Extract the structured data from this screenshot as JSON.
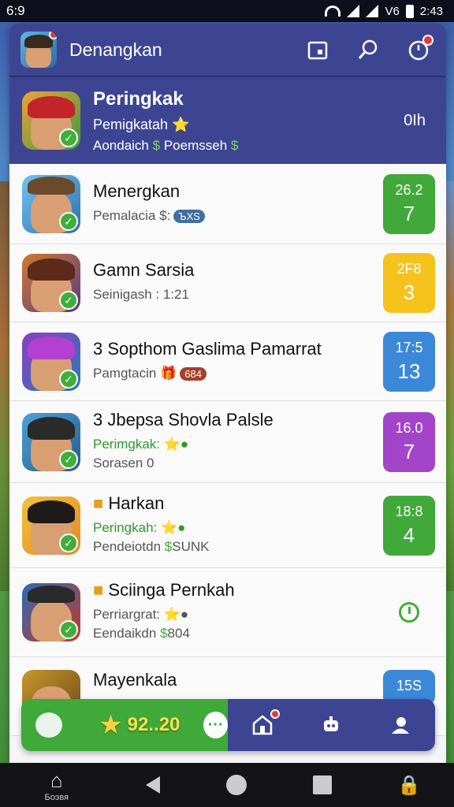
{
  "status": {
    "time_left": "6:9",
    "net": "V6",
    "time_right": "2:43"
  },
  "topbar": {
    "title": "Denangkan",
    "icons": [
      "calendar-icon",
      "search-icon",
      "clock-icon"
    ]
  },
  "hero": {
    "title": "Peringkak",
    "line1": "Pemigkatah",
    "line2": "Aondaich",
    "line2_b": "Poemsseh",
    "right": "0Ih"
  },
  "rows": [
    {
      "title": "Menergkan",
      "sub1": "Pemalacia",
      "pill": "ЪXS",
      "pill_color": "#3f6fa0",
      "s1": "26.2",
      "s2": "7",
      "color": "#41a83a"
    },
    {
      "title": "Gamn Sarsia",
      "sub1": "Seinigash : 1:21",
      "s1": "2F8",
      "s2": "3",
      "color": "#f6c31d"
    },
    {
      "title": "3 Sopthom Gaslima Pamarrat",
      "sub1": "Pamgtacin",
      "pill": "684",
      "pill_color": "#a4402c",
      "s1": "17:5",
      "s2": "13",
      "color": "#3b88d8"
    },
    {
      "title": "3 Jbepsa Shovla Palsle",
      "sub1": "Perimgkak:",
      "sub2": "Sorasen 0",
      "s1": "16.0",
      "s2": "7",
      "color": "#a245c9"
    },
    {
      "title": "Harkan",
      "sub1": "Peringkah:",
      "sub2": "Pendeiotdn",
      "sub2_b": "SUNK",
      "s1": "18:8",
      "s2": "4",
      "color": "#41a83a"
    },
    {
      "title": "Sciinga Pernkah",
      "sub1": "Perriargrat:",
      "sub2": "Eendaikdn",
      "sub2_b": "804"
    },
    {
      "title": "Mayenkala",
      "s1": "15S",
      "color": "#3b88d8"
    }
  ],
  "actionbar": {
    "score": "92..20"
  },
  "navbar": {
    "home_label": "Боэвя"
  },
  "colors": {
    "primary": "#3d4593",
    "green": "#3fa93a",
    "yellow": "#f6c31d",
    "blue": "#3b88d8",
    "purple": "#a245c9"
  }
}
